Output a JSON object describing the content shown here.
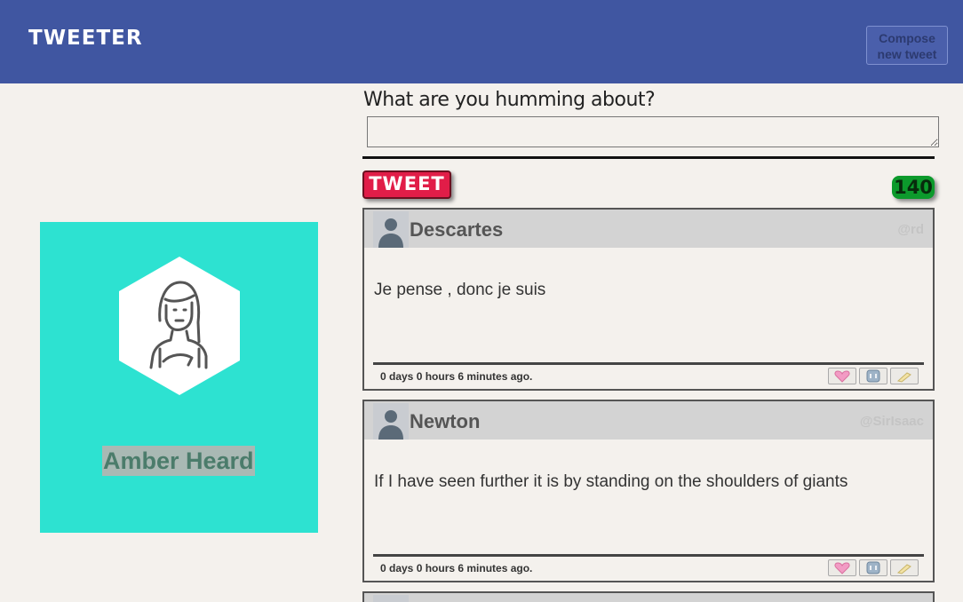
{
  "header": {
    "brand": "TWEETER",
    "compose_line1": "Compose",
    "compose_line2": "new tweet"
  },
  "profile": {
    "name": "Amber Heard",
    "avatar_icon": "woman-avatar-icon"
  },
  "compose": {
    "label": "What are you humming about?",
    "placeholder": "",
    "value": "",
    "tweet_button": "TWEET",
    "counter": "140"
  },
  "tweets": [
    {
      "author": "Descartes",
      "handle": "@rd",
      "content": "Je pense , donc je suis",
      "time": "0 days 0 hours 6 minutes ago."
    },
    {
      "author": "Newton",
      "handle": "@SirIsaac",
      "content": "If I have seen further it is by standing on the shoulders of giants",
      "time": "0 days 0 hours 6 minutes ago."
    }
  ],
  "colors": {
    "navbar": "#4056a1",
    "profile_card": "#2de2d1",
    "tweet_button": "#e11d48",
    "counter": "#0c9a2c"
  },
  "action_icons": [
    "heart-icon",
    "retweet-icon",
    "flag-icon"
  ]
}
